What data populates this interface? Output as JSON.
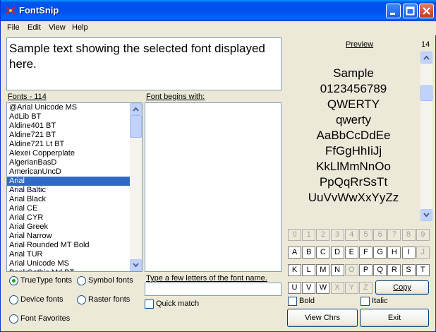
{
  "window": {
    "title": "FontSnip"
  },
  "menu": [
    "File",
    "Edit",
    "View",
    "Help"
  ],
  "sample_text": "Sample text showing the selected font displayed here.",
  "fonts_label": "Fonts - 114",
  "fonts": [
    "@Arial Unicode MS",
    "AdLib BT",
    "Aldine401 BT",
    "Aldine721 BT",
    "Aldine721 Lt BT",
    "Alexei Copperplate",
    "AlgerianBasD",
    "AmericanUncD",
    "Arial",
    "Arial Baltic",
    "Arial Black",
    "Arial CE",
    "Arial CYR",
    "Arial Greek",
    "Arial Narrow",
    "Arial Rounded MT Bold",
    "Arial TUR",
    "Arial Unicode MS",
    "BankGothic Md BT"
  ],
  "selected_font": "Arial",
  "begins_label": "Font begins with:",
  "type_label": "Type a few letters of the font name.",
  "type_value": "",
  "quick_match": "Quick match",
  "options": {
    "truetype": "TrueType fonts",
    "symbol": "Symbol fonts",
    "device": "Device fonts",
    "raster": "Raster fonts",
    "favorites": "Font Favorites"
  },
  "preview": {
    "title": "Preview",
    "size": "14",
    "lines": [
      "Sample",
      "0123456789",
      "QWERTY",
      "qwerty",
      "AaBbCcDdEe",
      "FfGgHhIiJj",
      "KkLlMmNnOo",
      "PpQqRrSsTt",
      "UuVvWwXxYyZz"
    ]
  },
  "keys": {
    "row1": [
      "0",
      "1",
      "2",
      "3",
      "4",
      "5",
      "6",
      "7",
      "8",
      "9"
    ],
    "row2": [
      "A",
      "B",
      "C",
      "D",
      "E",
      "F",
      "G",
      "H",
      "I",
      "J"
    ],
    "row3": [
      "K",
      "L",
      "M",
      "N",
      "O",
      "P",
      "Q",
      "R",
      "S",
      "T"
    ],
    "row4": [
      "U",
      "V",
      "W",
      "X",
      "Y",
      "Z"
    ]
  },
  "buttons": {
    "copy": "Copy",
    "view_chrs": "View Chrs",
    "exit": "Exit"
  },
  "bold": "Bold",
  "italic": "Italic"
}
